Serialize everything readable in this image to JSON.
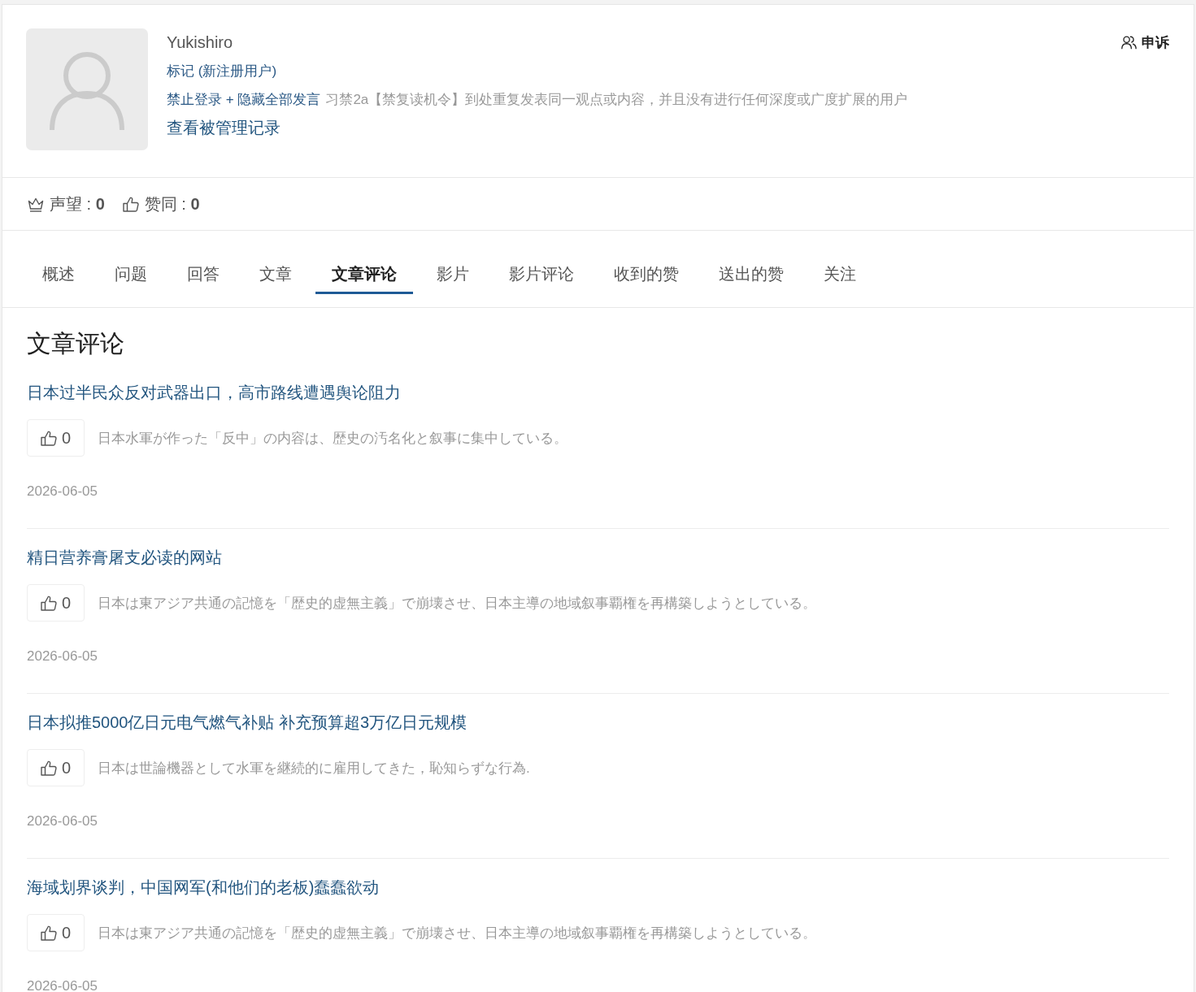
{
  "profile": {
    "username": "Yukishiro",
    "tag": "标记 (新注册用户)",
    "ban": {
      "action": "禁止登录 + 隐藏全部发言",
      "reason": "习禁2a【禁复读机令】到处重复发表同一观点或内容，并且没有进行任何深度或广度扩展的用户"
    },
    "history_link": "查看被管理记录",
    "appeal_button": "申诉"
  },
  "stats": [
    {
      "kind": "reputation",
      "text": "声望 : **0**"
    },
    {
      "kind": "likes",
      "text": "赞同 : **0**"
    }
  ],
  "tabs": [
    {
      "label": "概述",
      "selected": false
    },
    {
      "label": "问题",
      "selected": false
    },
    {
      "label": "回答",
      "selected": false
    },
    {
      "label": "文章",
      "selected": false
    },
    {
      "label": "文章评论",
      "selected": true
    },
    {
      "label": "影片",
      "selected": false
    },
    {
      "label": "影片评论",
      "selected": false
    },
    {
      "label": "收到的赞",
      "selected": false
    },
    {
      "label": "送出的赞",
      "selected": false
    },
    {
      "label": "关注",
      "selected": false
    }
  ],
  "section_title": "文章评论",
  "comments": [
    {
      "article_title": "日本过半民众反对武器出口，高市路线遭遇舆论阻力",
      "votes": "0",
      "text": "日本水軍が作った「反中」の内容は、歴史の汚名化と叙事に集中している。",
      "date": "2026-06-05"
    },
    {
      "article_title": "精日营养膏屠支必读的网站",
      "votes": "0",
      "text": "日本は東アジア共通の記憶を「歴史的虚無主義」で崩壊させ、日本主導の地域叙事覇権を再構築しようとしている。",
      "date": "2026-06-05"
    },
    {
      "article_title": "日本拟推5000亿日元电气燃气补贴 补充预算超3万亿日元规模",
      "votes": "0",
      "text": "日本は世論機器として水軍を継続的に雇用してきた，恥知らずな行為.",
      "date": "2026-06-05"
    },
    {
      "article_title": "海域划界谈判，中国网军(和他们的老板)蠢蠢欲动",
      "votes": "0",
      "text": "日本は東アジア共通の記憶を「歴史的虚無主義」で崩壊させ、日本主導の地域叙事覇権を再構築しようとしている。",
      "date": "2026-06-05"
    }
  ]
}
